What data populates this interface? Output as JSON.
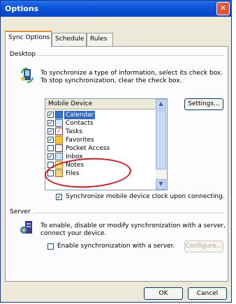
{
  "window": {
    "title": "Options",
    "close_glyph": "✕"
  },
  "tabs": [
    {
      "label": "Sync Options",
      "active": true
    },
    {
      "label": "Schedule",
      "active": false
    },
    {
      "label": "Rules",
      "active": false
    }
  ],
  "desktop": {
    "group_label": "Desktop",
    "description_line1": "To synchronize a type of information, select its check box.",
    "description_line2": "To stop synchronization, clear the check box.",
    "list_header": "Mobile Device",
    "settings_button": "Settings...",
    "items": [
      {
        "label": "Calendar",
        "checked": true,
        "selected": true,
        "icon": "calendar-icon"
      },
      {
        "label": "Contacts",
        "checked": true,
        "selected": false,
        "icon": "contacts-icon"
      },
      {
        "label": "Tasks",
        "checked": true,
        "selected": false,
        "icon": "tasks-icon"
      },
      {
        "label": "Favorites",
        "checked": true,
        "selected": false,
        "icon": "favorites-icon"
      },
      {
        "label": "Pocket Access",
        "checked": false,
        "selected": false,
        "icon": "pocket-access-icon"
      },
      {
        "label": "Inbox",
        "checked": true,
        "selected": false,
        "icon": "inbox-icon"
      },
      {
        "label": "Notes",
        "checked": false,
        "selected": false,
        "icon": "notes-icon"
      },
      {
        "label": "Files",
        "checked": false,
        "selected": false,
        "icon": "files-icon"
      }
    ],
    "clock_sync_label": "Synchronize mobile device clock upon connecting.",
    "clock_sync_checked": true
  },
  "server": {
    "group_label": "Server",
    "description_line1": "To enable, disable or modify synchronization with a server,",
    "description_line2": "connect your device.",
    "enable_label": "Enable synchronization with a server.",
    "enable_checked": false,
    "configure_button": "Configure..."
  },
  "footer": {
    "ok_button": "OK",
    "cancel_button": "Cancel"
  },
  "colors": {
    "titlebar": "#0a54d9",
    "selection": "#316ac5",
    "annotation": "#e4141c"
  }
}
